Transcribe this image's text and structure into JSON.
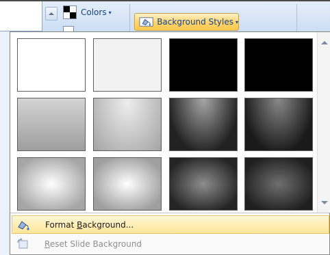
{
  "ribbon": {
    "colors_label": "Colors",
    "background_styles_label": "Background Styles",
    "caret": "▾",
    "accent_highlight": "#ffd36e"
  },
  "gallery": {
    "thumbnails": [
      {
        "id": "style-1",
        "fill": "#ffffff"
      },
      {
        "id": "style-2",
        "fill": "#f2f2f2"
      },
      {
        "id": "style-3",
        "fill": "#000000"
      },
      {
        "id": "style-4",
        "fill": "#000000"
      },
      {
        "id": "style-5",
        "fill": "linear-gradient(#d4d4d4, #9e9e9e)"
      },
      {
        "id": "style-6",
        "fill": "radial-gradient(ellipse at 50% 10%, #ededed, #a4a4a4)"
      },
      {
        "id": "style-7",
        "fill": "radial-gradient(ellipse at 50% 0%, #a8a8a8, #222222 75%)"
      },
      {
        "id": "style-8",
        "fill": "radial-gradient(ellipse at 50% 0%, #8a8a8a, #1a1a1a 75%)"
      },
      {
        "id": "style-9",
        "fill": "radial-gradient(ellipse at 50% 50%, #ffffff, #a6a6a6 80%)"
      },
      {
        "id": "style-10",
        "fill": "radial-gradient(ellipse at 50% 50%, #ffffff, #9f9f9f 80%)"
      },
      {
        "id": "style-11",
        "fill": "radial-gradient(ellipse at 50% 50%, #8d8d8d, #242424 80%)"
      },
      {
        "id": "style-12",
        "fill": "radial-gradient(ellipse at 50% 50%, #6f6f6f, #1f1f1f 80%)"
      }
    ]
  },
  "menu": {
    "format_background": {
      "before": "Format ",
      "accel": "B",
      "after": "ackground..."
    },
    "reset_slide_background": {
      "before": "",
      "accel": "R",
      "after": "eset Slide Background"
    }
  },
  "icons": {
    "paint_bucket": "paint-bucket-icon",
    "reset": "reset-background-icon",
    "colors": "theme-colors-icon"
  }
}
